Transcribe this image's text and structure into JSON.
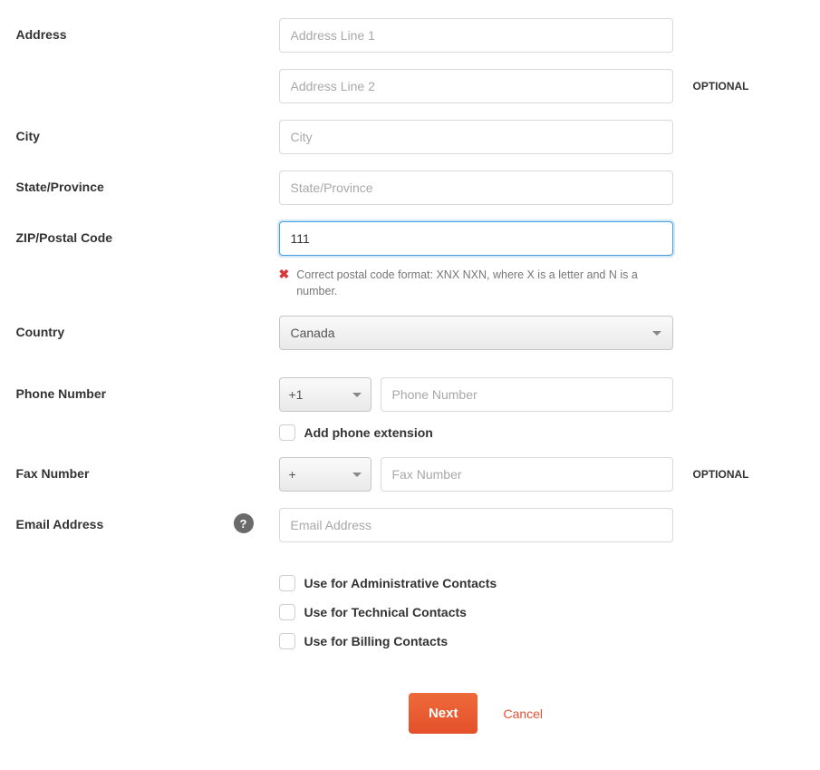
{
  "labels": {
    "address": "Address",
    "city": "City",
    "state": "State/Province",
    "zip": "ZIP/Postal Code",
    "country": "Country",
    "phone": "Phone Number",
    "fax": "Fax Number",
    "email": "Email Address"
  },
  "optional_text": "OPTIONAL",
  "placeholders": {
    "address1": "Address Line 1",
    "address2": "Address Line 2",
    "city": "City",
    "state": "State/Province",
    "phone": "Phone Number",
    "fax": "Fax Number",
    "email": "Email Address"
  },
  "values": {
    "zip": "111",
    "country": "Canada",
    "phone_prefix": "+1",
    "fax_prefix": "+"
  },
  "error": {
    "zip": "Correct postal code format: XNX NXN, where X is a letter and N is a number."
  },
  "checkboxes": {
    "add_extension": "Add phone extension",
    "admin": "Use for Administrative Contacts",
    "tech": "Use for Technical Contacts",
    "billing": "Use for Billing Contacts"
  },
  "buttons": {
    "next": "Next",
    "cancel": "Cancel"
  },
  "help_icon": "?"
}
